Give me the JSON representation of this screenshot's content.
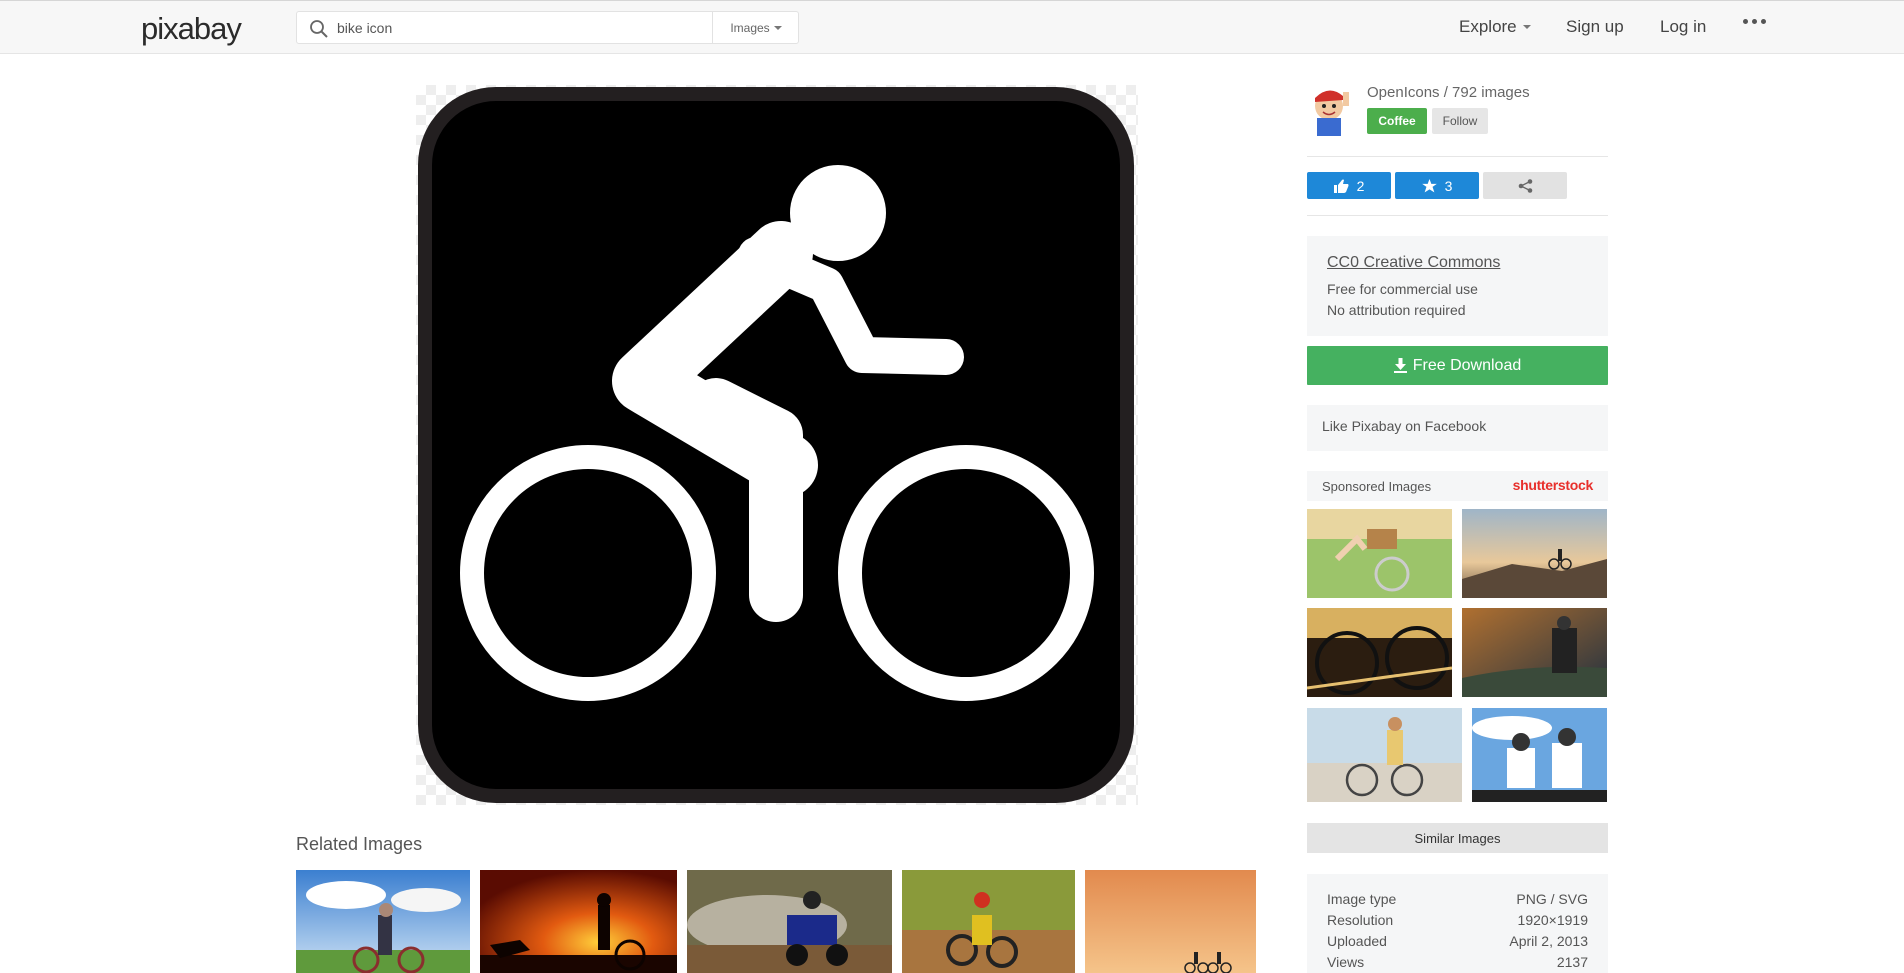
{
  "header": {
    "logo": "pixabay",
    "search_value": "bike icon",
    "search_type": "Images",
    "nav": {
      "explore": "Explore",
      "signup": "Sign up",
      "login": "Log in"
    }
  },
  "author": {
    "name_line": "OpenIcons / 792 images",
    "coffee": "Coffee",
    "follow": "Follow"
  },
  "actions": {
    "likes": "2",
    "favorites": "3"
  },
  "license": {
    "title": "CC0 Creative Commons",
    "line1": "Free for commercial use",
    "line2": "No attribution required"
  },
  "download_label": "Free Download",
  "facebook_label": "Like Pixabay on Facebook",
  "sponsored": {
    "title": "Sponsored Images",
    "brand": "shutterstock"
  },
  "similar_label": "Similar Images",
  "related_title": "Related Images",
  "info": {
    "rows": [
      {
        "label": "Image type",
        "value": "PNG / SVG"
      },
      {
        "label": "Resolution",
        "value": "1920×1919"
      },
      {
        "label": "Uploaded",
        "value": "April 2, 2013"
      },
      {
        "label": "Views",
        "value": "2137"
      }
    ]
  },
  "colors": {
    "accent_green": "#45b160",
    "accent_blue": "#1e88d8",
    "brand_red": "#e8302c"
  }
}
